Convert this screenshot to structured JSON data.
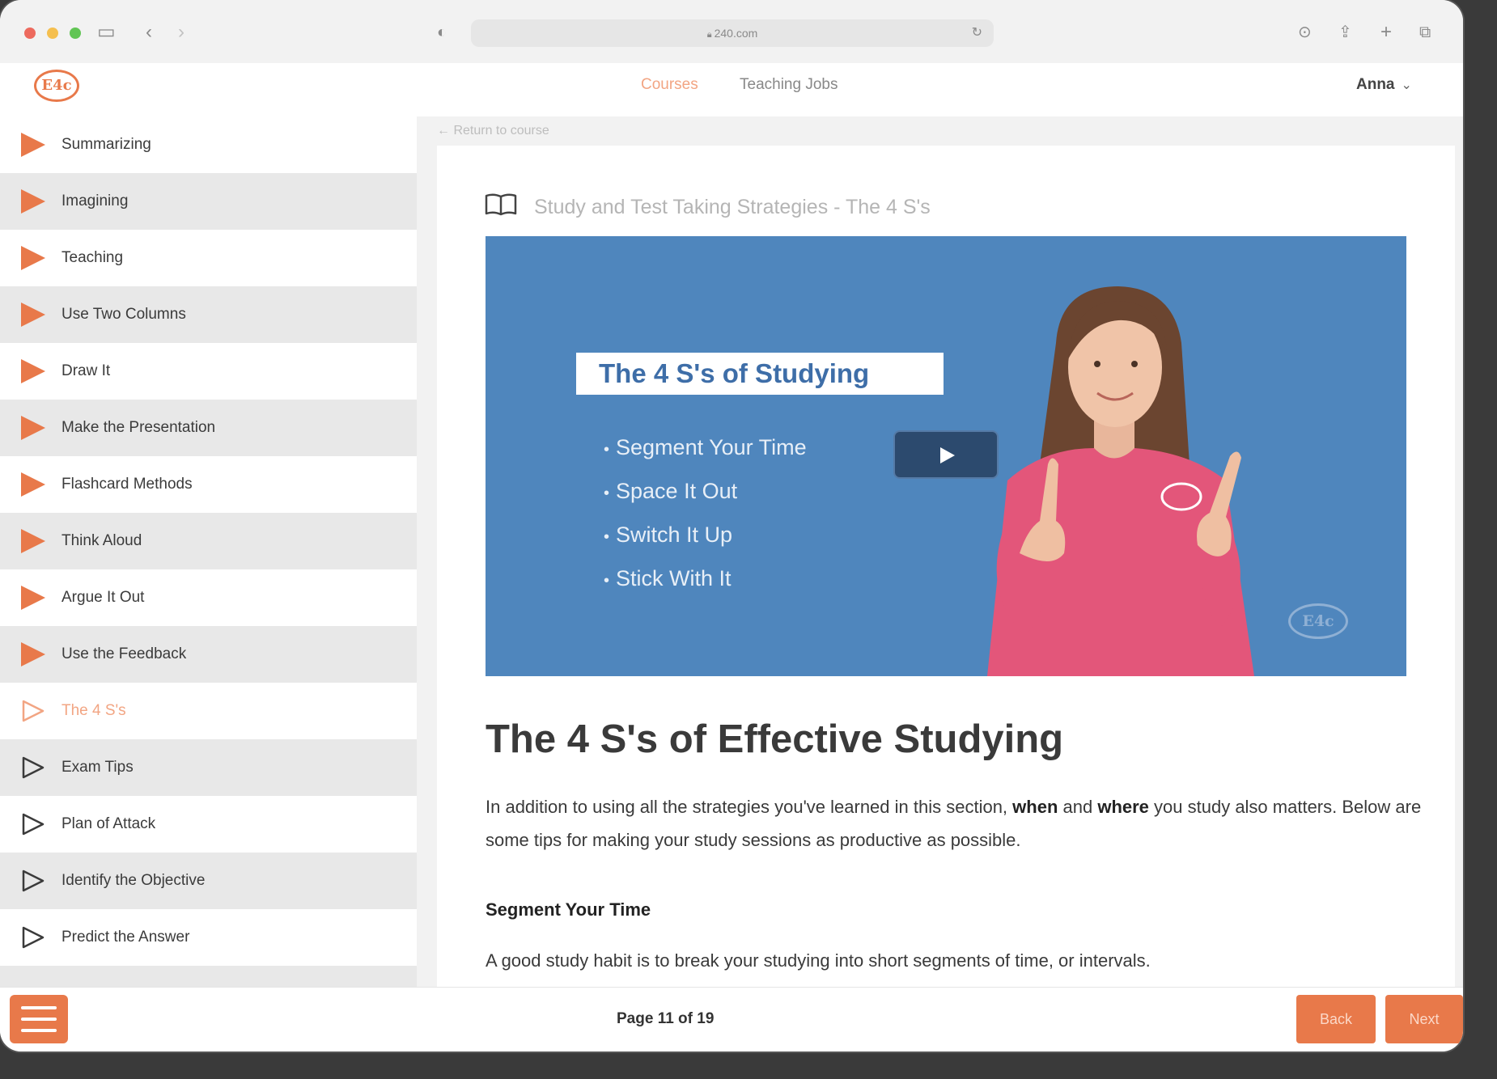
{
  "browser": {
    "url": "240.com",
    "traffic_colors": [
      "#ed6a5e",
      "#f5bf4f",
      "#61c554"
    ]
  },
  "brand": {
    "logo_text": "E4c",
    "accent": "#e8794a"
  },
  "nav": {
    "links": [
      {
        "label": "Courses",
        "active": true
      },
      {
        "label": "Teaching Jobs",
        "active": false
      }
    ],
    "user": "Anna"
  },
  "sidebar": {
    "items": [
      {
        "label": "Summarizing",
        "icon": "play-filled-icon"
      },
      {
        "label": "Imagining",
        "icon": "play-filled-icon"
      },
      {
        "label": "Teaching",
        "icon": "play-filled-icon"
      },
      {
        "label": "Use Two Columns",
        "icon": "play-filled-icon"
      },
      {
        "label": "Draw It",
        "icon": "play-filled-icon"
      },
      {
        "label": "Make the Presentation",
        "icon": "play-filled-icon"
      },
      {
        "label": "Flashcard Methods",
        "icon": "play-filled-icon"
      },
      {
        "label": "Think Aloud",
        "icon": "play-filled-icon"
      },
      {
        "label": "Argue It Out",
        "icon": "play-filled-icon"
      },
      {
        "label": "Use the Feedback",
        "icon": "play-filled-icon"
      },
      {
        "label": "The 4 S's",
        "icon": "play-outline-icon",
        "active": true
      },
      {
        "label": "Exam Tips",
        "icon": "play-outline-icon"
      },
      {
        "label": "Plan of Attack",
        "icon": "play-outline-icon"
      },
      {
        "label": "Identify the Objective",
        "icon": "play-outline-icon"
      },
      {
        "label": "Predict the Answer",
        "icon": "play-outline-icon"
      }
    ]
  },
  "content": {
    "return_link": "← Return to course",
    "lesson_title": "Study and Test Taking Strategies - The 4 S's",
    "video": {
      "title": "The 4 S's of Studying",
      "bullets": [
        "Segment Your Time",
        "Space It Out",
        "Switch It Up",
        "Stick With It"
      ],
      "watermark": "E4c"
    },
    "heading": "The 4 S's of Effective Studying",
    "para_1": "In addition to using all the strategies you've learned in this section, ",
    "para_bold_1": "when",
    "para_2": " and ",
    "para_bold_2": "where",
    "para_3": " you study also matters. Below are some tips for making your study sessions as productive as possible.",
    "subheading": "Segment Your Time",
    "para_next": "A good study habit is to break your studying into short segments of time, or intervals."
  },
  "footer": {
    "page_info": "Page 11 of 19",
    "back_label": "Back",
    "next_label": "Next"
  }
}
